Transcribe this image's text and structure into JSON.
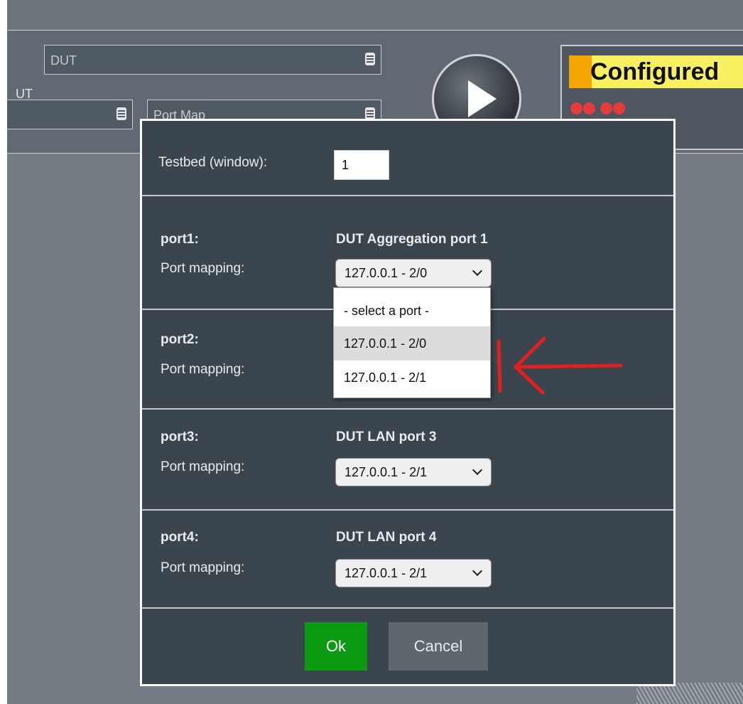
{
  "header": {
    "dut_label_partial": "UT",
    "dut_field_value": "DUT",
    "port_map_field_value": "Port Map",
    "status_text": "Configured",
    "colors": {
      "status_label_bg": "#f8f060",
      "status_accent": "#f5a400",
      "led": "#e43b3b"
    }
  },
  "dialog": {
    "testbed_label": "Testbed (window):",
    "testbed_value": "1",
    "ports": [
      {
        "name": "port1:",
        "description": "DUT Aggregation port 1",
        "mapping_label": "Port mapping:",
        "selected": "127.0.0.1 - 2/0"
      },
      {
        "name": "port2:",
        "description": "",
        "mapping_label": "Port mapping:",
        "selected": ""
      },
      {
        "name": "port3:",
        "description": "DUT LAN port 3",
        "mapping_label": "Port mapping:",
        "selected": "127.0.0.1 - 2/1"
      },
      {
        "name": "port4:",
        "description": "DUT LAN port 4",
        "mapping_label": "Port mapping:",
        "selected": "127.0.0.1 - 2/1"
      }
    ],
    "dropdown_options": [
      "- select a port -",
      "127.0.0.1 - 2/0",
      "127.0.0.1 - 2/1"
    ],
    "ok_label": "Ok",
    "cancel_label": "Cancel",
    "colors": {
      "ok_bg": "#0c9a12",
      "cancel_bg": "#5f676e",
      "dialog_bg": "#3b454d"
    }
  },
  "annotation": {
    "color": "#e02020",
    "icon": "red-arrow-icon"
  }
}
